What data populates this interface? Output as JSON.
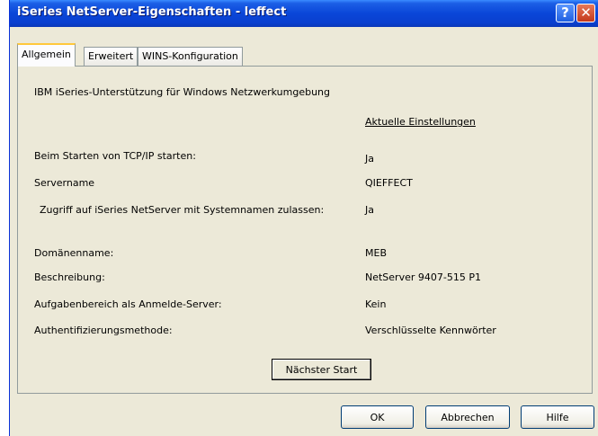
{
  "window": {
    "title": "iSeries NetServer-Eigenschaften - leffect"
  },
  "titlebar": {
    "help_glyph": "?",
    "close_glyph": "✕"
  },
  "tabs": [
    {
      "label": "Allgemein"
    },
    {
      "label": "Erweitert"
    },
    {
      "label": "WINS-Konfiguration"
    }
  ],
  "general": {
    "description": "IBM iSeries-Unterstützung für Windows Netzwerkumgebung",
    "current_settings_header": "Aktuelle Einstellungen",
    "fields": [
      {
        "label": "Beim Starten von TCP/IP starten:",
        "value": "Ja"
      },
      {
        "label": "Servername",
        "value": "QIEFFECT"
      },
      {
        "label": "Zugriff auf iSeries NetServer mit Systemnamen zulassen:",
        "value": "Ja"
      },
      {
        "label": "Domänenname:",
        "value": "MEB"
      },
      {
        "label": "Beschreibung:",
        "value": "NetServer 9407-515 P1"
      },
      {
        "label": "Aufgabenbereich als Anmelde-Server:",
        "value": "Kein"
      },
      {
        "label": "Authentifizierungsmethode:",
        "value": "Verschlüsselte Kennwörter"
      }
    ],
    "next_start_label": "Nächster Start"
  },
  "footer": {
    "ok_label": "OK",
    "cancel_label": "Abbrechen",
    "help_label": "Hilfe"
  },
  "colors": {
    "titlebar": "#0a46d8",
    "dialog_bg": "#ece9d8",
    "tab_highlight": "#ffc83c",
    "close_button": "#c3391b"
  }
}
